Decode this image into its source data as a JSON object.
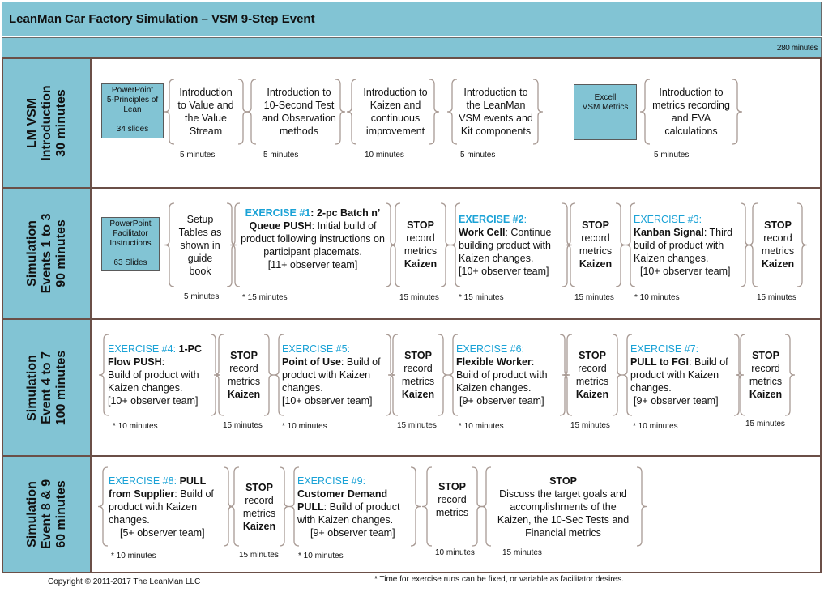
{
  "header": {
    "title": "LeanMan Car Factory Simulation – VSM 9-Step Event",
    "total_time": "280 minutes"
  },
  "rows": [
    {
      "label": [
        "LM VSM",
        "Introduction",
        "30 minutes"
      ],
      "resources": [
        {
          "lines": [
            "PowerPoint",
            "5-Principles of",
            "Lean",
            "",
            "34 slides"
          ]
        },
        {
          "lines": [
            "Excell",
            "VSM Metrics"
          ]
        }
      ],
      "steps": [
        {
          "text": [
            "Introduction",
            "to Value and",
            "the Value",
            "Stream"
          ],
          "duration": "5 minutes"
        },
        {
          "text": [
            "Introduction to",
            "10-Second Test",
            "and Observation",
            "methods"
          ],
          "duration": "5 minutes"
        },
        {
          "text": [
            "Introduction to",
            "Kaizen and",
            "continuous",
            "improvement"
          ],
          "duration": "10 minutes"
        },
        {
          "text": [
            "Introduction to",
            "the LeanMan",
            "VSM events and",
            "Kit components"
          ],
          "duration": "5 minutes"
        },
        {
          "text": [
            "Introduction to",
            "metrics recording",
            "and EVA",
            "calculations"
          ],
          "duration": "5 minutes"
        }
      ]
    },
    {
      "label": [
        "Simulation",
        "Events 1 to 3",
        "90 minutes"
      ],
      "resources": [
        {
          "lines": [
            "PowerPoint",
            "Facilitator",
            "Instructions",
            "",
            "63  Slides"
          ]
        }
      ],
      "steps": [
        {
          "text": [
            "Setup",
            "Tables as",
            "shown in",
            "guide",
            "book"
          ],
          "duration": "5 minutes"
        },
        {
          "exercise": "EXERCISE #1",
          "name": ": 2-pc Batch n’ Queue PUSH",
          "desc": ": Initial build of product following instructions on participant placemats.",
          "team": "[11+ observer team]",
          "duration": "* 15 minutes"
        },
        {
          "stop": "STOP",
          "lines": [
            "record",
            "metrics"
          ],
          "kaizen": "Kaizen",
          "duration": "15 minutes"
        },
        {
          "exercise": "EXERCISE #2",
          "name": "Work Cell",
          "desc": ": Continue building product with Kaizen changes.",
          "team": "[10+ observer team]",
          "duration": "* 15 minutes"
        },
        {
          "stop": "STOP",
          "lines": [
            "record",
            "metrics"
          ],
          "kaizen": "Kaizen",
          "duration": "15 minutes"
        },
        {
          "exercise": "EXERCISE #3",
          "name": "Kanban Signal",
          "desc": ": Third build of product with Kaizen changes.",
          "team": "[10+ observer team]",
          "duration": "* 10 minutes"
        },
        {
          "stop": "STOP",
          "lines": [
            "record",
            "metrics"
          ],
          "kaizen": "Kaizen",
          "duration": "15 minutes"
        }
      ]
    },
    {
      "label": [
        "Simulation",
        "Event 4 to 7",
        "100 minutes"
      ],
      "steps": [
        {
          "exercise": "EXERCISE #4",
          "name": "1-PC Flow PUSH",
          "desc": "Build of product with Kaizen changes.",
          "team": "[10+ observer team]",
          "duration": "* 10 minutes"
        },
        {
          "stop": "STOP",
          "lines": [
            "record",
            "metrics"
          ],
          "kaizen": "Kaizen",
          "duration": "15 minutes"
        },
        {
          "exercise": "EXERCISE #5",
          "name": "Point of Use",
          "desc": ": Build of product with Kaizen changes.",
          "team": "[10+ observer team]",
          "duration": "* 10 minutes"
        },
        {
          "stop": "STOP",
          "lines": [
            "record",
            "metrics"
          ],
          "kaizen": "Kaizen",
          "duration": "15 minutes"
        },
        {
          "exercise": "EXERCISE #6",
          "name": "Flexible Worker",
          "desc": "Build of product with Kaizen changes.",
          "team": "[9+ observer team]",
          "duration": "* 10 minutes"
        },
        {
          "stop": "STOP",
          "lines": [
            "record",
            "metrics"
          ],
          "kaizen": "Kaizen",
          "duration": "15 minutes"
        },
        {
          "exercise": "EXERCISE #7",
          "name": "PULL to FGI",
          "desc": ": Build of product with Kaizen changes.",
          "team": "[9+ observer team]",
          "duration": "* 10 minutes"
        },
        {
          "stop": "STOP",
          "lines": [
            "record",
            "metrics"
          ],
          "kaizen": "Kaizen",
          "duration": "15 minutes"
        }
      ]
    },
    {
      "label": [
        "Simulation",
        "Event 8 & 9",
        "60 minutes"
      ],
      "steps": [
        {
          "exercise": "EXERCISE #8",
          "name": "PULL from Supplier",
          "desc": ": Build of product with Kaizen changes.",
          "team": "[5+ observer team]",
          "duration": "* 10 minutes"
        },
        {
          "stop": "STOP",
          "lines": [
            "record",
            "metrics"
          ],
          "kaizen": "Kaizen",
          "duration": "15 minutes"
        },
        {
          "exercise": "EXERCISE #9",
          "name": "Customer Demand PULL",
          "desc": ": Build of product with Kaizen changes.",
          "team": "[9+ observer team]",
          "duration": "* 10 minutes"
        },
        {
          "stop": "STOP",
          "lines": [
            "record",
            "metrics"
          ],
          "duration": "10 minutes"
        },
        {
          "stop": "STOP",
          "lines": [
            "Discuss the target goals and",
            "accomplishments of the",
            "Kaizen, the 10-Sec Tests and",
            "Financial metrics"
          ],
          "duration": "15 minutes"
        }
      ]
    }
  ],
  "footer": {
    "copyright": "Copyright © 2011-2017 The LeanMan LLC",
    "note": "* Time for exercise runs can be fixed, or variable as facilitator desires."
  },
  "colors": {
    "header_bg": "#82c4d4",
    "exercise_text": "#1aa2d6",
    "border": "#6b4f47",
    "brace": "#a89a94"
  }
}
